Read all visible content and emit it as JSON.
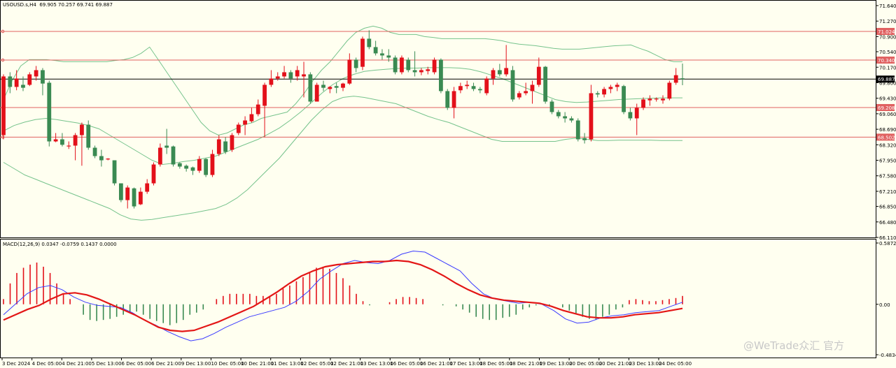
{
  "header": {
    "symbol": "USOUSD.s,H4",
    "ohlc": "69.905 70.257 69.741 69.887"
  },
  "macd_header": {
    "label": "MACD(12,26,9) 0.0347 -0.0759 0.1437 0.0000"
  },
  "watermark": "@WeTrade众汇 官方",
  "colors": {
    "background": "#fffff0",
    "bull": "#e3101a",
    "bear": "#3a8a52",
    "band": "#76c38c",
    "hline": "#e06060",
    "price_line": "#000000",
    "macd_line": "#3b3bff",
    "signal_line": "#e31616"
  },
  "chart_data": [
    {
      "type": "candlestick",
      "name": "price",
      "ylim": [
        66.11,
        71.64
      ],
      "yticks": [
        "71.640",
        "71.270",
        "70.900",
        "70.540",
        "70.170",
        "69.800",
        "69.430",
        "69.060",
        "68.690",
        "68.320",
        "67.950",
        "67.580",
        "67.210",
        "66.850",
        "66.480",
        "66.110"
      ],
      "current_price": "69.887",
      "levels": [
        {
          "value": 71.024,
          "label": "71.024"
        },
        {
          "value": 70.34,
          "label": "70.340"
        },
        {
          "value": 69.208,
          "label": "69.208"
        },
        {
          "value": 68.502,
          "label": "68.502"
        }
      ],
      "x_labels": [
        "3 Dec 2024",
        "4 Dec 05:00",
        "4 Dec 21:00",
        "5 Dec 13:00",
        "6 Dec 05:00",
        "6 Dec 21:00",
        "9 Dec 13:00",
        "10 Dec 05:00",
        "10 Dec 21:00",
        "11 Dec 13:00",
        "12 Dec 05:00",
        "12 Dec 21:00",
        "13 Dec 13:00",
        "16 Dec 05:00",
        "16 Dec 21:00",
        "17 Dec 13:00",
        "18 Dec 05:00",
        "18 Dec 21:00",
        "19 Dec 13:00",
        "20 Dec 05:00",
        "20 Dec 21:00",
        "23 Dec 13:00",
        "24 Dec 05:00"
      ],
      "candles": [
        [
          68.55,
          69.95,
          70.0,
          68.45
        ],
        [
          69.95,
          69.7,
          70.05,
          69.55
        ],
        [
          69.7,
          69.9,
          70.1,
          69.62
        ],
        [
          69.75,
          69.68,
          69.95,
          69.6
        ],
        [
          69.75,
          70.0,
          70.05,
          69.72
        ],
        [
          69.95,
          70.1,
          70.2,
          69.85
        ],
        [
          70.1,
          69.78,
          70.15,
          69.5
        ],
        [
          69.8,
          68.4,
          69.85,
          68.28
        ],
        [
          68.4,
          68.45,
          68.6,
          68.38
        ],
        [
          68.45,
          68.32,
          68.6,
          68.28
        ],
        [
          68.28,
          68.3,
          68.4,
          68.22
        ],
        [
          68.3,
          68.55,
          68.6,
          67.95
        ],
        [
          68.55,
          68.8,
          68.85,
          67.82
        ],
        [
          68.8,
          68.25,
          68.9,
          68.2
        ],
        [
          68.25,
          68.05,
          68.3,
          68.0
        ],
        [
          68.05,
          67.95,
          68.2,
          67.8
        ],
        [
          67.97,
          67.99,
          68.0,
          67.95
        ],
        [
          67.95,
          67.4,
          67.95,
          67.35
        ],
        [
          67.4,
          67.0,
          67.4,
          66.95
        ],
        [
          67.0,
          67.3,
          67.35,
          66.8
        ],
        [
          67.28,
          66.85,
          67.3,
          66.8
        ],
        [
          66.9,
          67.2,
          67.3,
          66.88
        ],
        [
          67.2,
          67.4,
          67.5,
          67.15
        ],
        [
          67.4,
          67.85,
          67.9,
          67.35
        ],
        [
          67.85,
          68.25,
          68.35,
          67.8
        ],
        [
          68.3,
          68.25,
          68.7,
          68.1
        ],
        [
          68.28,
          67.85,
          68.3,
          67.8
        ],
        [
          67.88,
          67.8,
          67.9,
          67.75
        ],
        [
          67.82,
          67.75,
          67.85,
          67.68
        ],
        [
          67.78,
          67.7,
          67.8,
          67.6
        ],
        [
          67.7,
          67.98,
          68.05,
          67.65
        ],
        [
          67.98,
          67.6,
          68.0,
          67.55
        ],
        [
          67.6,
          68.1,
          68.2,
          67.55
        ],
        [
          68.1,
          68.45,
          68.55,
          68.05
        ],
        [
          68.4,
          68.15,
          68.5,
          68.1
        ],
        [
          68.2,
          68.55,
          68.6,
          68.15
        ],
        [
          68.6,
          68.8,
          68.85,
          68.55
        ],
        [
          68.8,
          68.9,
          69.0,
          68.55
        ],
        [
          68.88,
          69.05,
          69.2,
          68.85
        ],
        [
          69.05,
          69.28,
          69.4,
          69.0
        ],
        [
          69.25,
          69.75,
          69.8,
          68.5
        ],
        [
          69.75,
          69.9,
          70.1,
          69.7
        ],
        [
          69.9,
          69.95,
          70.05,
          69.85
        ],
        [
          69.95,
          70.05,
          70.2,
          69.9
        ],
        [
          70.05,
          69.9,
          70.1,
          69.8
        ],
        [
          69.95,
          70.1,
          70.2,
          69.85
        ],
        [
          69.95,
          70.0,
          70.3,
          69.45
        ],
        [
          70.0,
          69.35,
          70.05,
          69.3
        ],
        [
          69.35,
          69.75,
          69.8,
          69.35
        ],
        [
          69.75,
          69.68,
          69.85,
          69.6
        ],
        [
          69.65,
          69.7,
          69.72,
          69.55
        ],
        [
          69.72,
          69.68,
          69.8,
          69.55
        ],
        [
          69.68,
          69.78,
          69.8,
          69.6
        ],
        [
          69.78,
          70.35,
          70.5,
          69.75
        ],
        [
          70.35,
          70.15,
          70.4,
          70.05
        ],
        [
          70.18,
          70.85,
          70.9,
          70.1
        ],
        [
          70.85,
          70.65,
          71.05,
          70.6
        ],
        [
          70.65,
          70.5,
          70.8,
          70.45
        ],
        [
          70.5,
          70.45,
          70.6,
          70.35
        ],
        [
          70.45,
          70.4,
          70.6,
          70.3
        ],
        [
          70.4,
          70.05,
          70.45,
          70.0
        ],
        [
          70.05,
          70.4,
          70.45,
          70.0
        ],
        [
          70.35,
          70.1,
          70.4,
          70.05
        ],
        [
          70.1,
          70.05,
          70.55,
          69.95
        ],
        [
          70.05,
          70.1,
          70.15,
          69.98
        ],
        [
          70.08,
          70.12,
          70.18,
          70.0
        ],
        [
          70.05,
          70.35,
          70.4,
          70.0
        ],
        [
          70.35,
          69.6,
          70.38,
          69.55
        ],
        [
          69.6,
          69.2,
          69.65,
          69.15
        ],
        [
          69.2,
          69.6,
          69.7,
          68.95
        ],
        [
          69.62,
          69.72,
          69.8,
          69.55
        ],
        [
          69.72,
          69.75,
          69.85,
          69.65
        ],
        [
          69.72,
          69.65,
          69.8,
          69.6
        ],
        [
          69.65,
          69.62,
          69.7,
          69.55
        ],
        [
          69.55,
          69.9,
          69.95,
          69.5
        ],
        [
          69.9,
          70.1,
          70.15,
          69.75
        ],
        [
          70.1,
          70.0,
          70.25,
          69.95
        ],
        [
          70.0,
          70.15,
          70.7,
          69.95
        ],
        [
          70.1,
          69.4,
          70.2,
          69.35
        ],
        [
          69.45,
          69.55,
          69.6,
          69.4
        ],
        [
          69.55,
          69.6,
          69.8,
          69.5
        ],
        [
          69.6,
          69.75,
          69.85,
          69.3
        ],
        [
          69.75,
          70.18,
          70.4,
          69.7
        ],
        [
          70.18,
          69.35,
          70.2,
          69.3
        ],
        [
          69.35,
          69.1,
          69.4,
          69.05
        ],
        [
          69.1,
          69.0,
          69.15,
          68.95
        ],
        [
          69.0,
          68.95,
          69.1,
          68.85
        ],
        [
          68.95,
          68.9,
          69.0,
          68.85
        ],
        [
          68.9,
          68.45,
          68.95,
          68.4
        ],
        [
          68.48,
          68.43,
          68.6,
          68.35
        ],
        [
          68.45,
          69.55,
          69.75,
          68.4
        ],
        [
          69.55,
          69.52,
          69.6,
          69.45
        ],
        [
          69.52,
          69.65,
          69.7,
          69.45
        ],
        [
          69.65,
          69.7,
          69.75,
          69.55
        ],
        [
          69.7,
          69.75,
          69.8,
          69.6
        ],
        [
          69.72,
          69.1,
          69.75,
          69.05
        ],
        [
          69.1,
          68.95,
          69.2,
          68.9
        ],
        [
          68.95,
          69.2,
          69.3,
          68.55
        ],
        [
          69.2,
          69.4,
          69.45,
          69.15
        ],
        [
          69.38,
          69.42,
          69.5,
          69.25
        ],
        [
          69.4,
          69.42,
          69.45,
          69.35
        ],
        [
          69.38,
          69.42,
          69.5,
          69.3
        ],
        [
          69.42,
          69.8,
          69.85,
          69.38
        ],
        [
          69.8,
          69.98,
          70.15,
          69.75
        ],
        [
          69.905,
          69.887,
          70.257,
          69.741
        ]
      ],
      "bands_upper": [
        69.4,
        69.85,
        70.2,
        70.35,
        70.35,
        70.35,
        70.33,
        70.3,
        70.3,
        70.3,
        70.3,
        70.3,
        70.3,
        70.33,
        70.35,
        70.4,
        70.5,
        70.65,
        70.35,
        70.05,
        69.75,
        69.45,
        69.15,
        68.85,
        68.65,
        68.55,
        68.6,
        68.7,
        68.8,
        68.85,
        68.95,
        69.0,
        69.05,
        69.1,
        69.3,
        69.55,
        69.85,
        70.1,
        70.3,
        70.55,
        70.8,
        71.0,
        71.1,
        71.15,
        71.1,
        71.0,
        70.95,
        70.95,
        70.95,
        70.9,
        70.88,
        70.85,
        70.85,
        70.85,
        70.85,
        70.85,
        70.85,
        70.83,
        70.8,
        70.75,
        70.72,
        70.7,
        70.68,
        70.65,
        70.62,
        70.6,
        70.6,
        70.6,
        70.62,
        70.64,
        70.66,
        70.68,
        70.69,
        70.7,
        70.62,
        70.55,
        70.45,
        70.35,
        70.3,
        70.3
      ],
      "bands_middle": [
        68.65,
        68.78,
        68.86,
        68.92,
        68.95,
        68.92,
        68.88,
        68.84,
        68.78,
        68.7,
        68.55,
        68.4,
        68.25,
        68.1,
        67.95,
        67.85,
        67.88,
        67.92,
        67.95,
        68.0,
        68.05,
        68.15,
        68.25,
        68.35,
        68.45,
        68.58,
        68.72,
        68.9,
        69.1,
        69.32,
        69.55,
        69.75,
        69.9,
        70.0,
        70.07,
        70.1,
        70.12,
        70.14,
        70.15,
        70.15,
        70.16,
        70.16,
        70.16,
        70.15,
        70.12,
        70.06,
        69.98,
        69.9,
        69.8,
        69.7,
        69.6,
        69.5,
        69.4,
        69.35,
        69.33,
        69.34,
        69.36,
        69.38,
        69.4,
        69.41,
        69.42,
        69.43,
        69.44,
        69.44,
        69.44
      ],
      "bands_lower": [
        67.9,
        67.75,
        67.6,
        67.5,
        67.4,
        67.3,
        67.2,
        67.1,
        67.0,
        66.9,
        66.8,
        66.65,
        66.55,
        66.52,
        66.54,
        66.58,
        66.62,
        66.66,
        66.7,
        66.75,
        66.8,
        66.9,
        67.05,
        67.25,
        67.5,
        67.75,
        68.0,
        68.3,
        68.6,
        68.9,
        69.15,
        69.35,
        69.45,
        69.48,
        69.45,
        69.4,
        69.35,
        69.3,
        69.2,
        69.1,
        69.0,
        68.92,
        68.85,
        68.75,
        68.65,
        68.55,
        68.45,
        68.4,
        68.4,
        68.4,
        68.4,
        68.4,
        68.4,
        68.45,
        68.48,
        68.45,
        68.42,
        68.42,
        68.43,
        68.43,
        68.43,
        68.43,
        68.42,
        68.42,
        68.42
      ]
    },
    {
      "type": "macd",
      "name": "MACD(12,26,9)",
      "ylim": [
        -0.4834,
        0.5872
      ],
      "yticks": [
        "0.5872",
        "0.00",
        "-0.4834"
      ],
      "histogram": [
        0.05,
        0.2,
        0.3,
        0.35,
        0.38,
        0.4,
        0.36,
        0.3,
        0.2,
        0.1,
        0.05,
        0.0,
        -0.1,
        -0.15,
        -0.16,
        -0.15,
        -0.14,
        -0.12,
        -0.1,
        -0.08,
        -0.07,
        -0.1,
        -0.14,
        -0.16,
        -0.18,
        -0.2,
        -0.18,
        -0.15,
        -0.1,
        -0.08,
        -0.05,
        0.0,
        0.05,
        0.08,
        0.1,
        0.1,
        0.1,
        0.1,
        0.08,
        0.08,
        0.08,
        0.1,
        0.15,
        0.18,
        0.22,
        0.26,
        0.3,
        0.35,
        0.36,
        0.34,
        0.3,
        0.25,
        0.18,
        0.1,
        0.03,
        -0.01,
        0.0,
        0.0,
        0.02,
        0.05,
        0.07,
        0.07,
        0.06,
        0.05,
        0.0,
        0.0,
        -0.01,
        0.0,
        -0.02,
        -0.05,
        -0.08,
        -0.12,
        -0.14,
        -0.15,
        -0.15,
        -0.13,
        -0.12,
        -0.1,
        -0.05,
        -0.03,
        -0.01,
        0.0,
        -0.01,
        0.0,
        -0.03,
        -0.06,
        -0.09,
        -0.12,
        -0.14,
        -0.15,
        -0.12,
        -0.1,
        -0.05,
        -0.03,
        0.04,
        0.05,
        0.04,
        0.03,
        0.03,
        0.04,
        0.05,
        0.06,
        0.08
      ],
      "macd_line": [
        -0.1,
        0.0,
        0.1,
        0.16,
        0.18,
        0.14,
        0.07,
        0.02,
        -0.01,
        -0.02,
        -0.03,
        -0.08,
        -0.15,
        -0.2,
        -0.26,
        -0.31,
        -0.35,
        -0.33,
        -0.28,
        -0.22,
        -0.17,
        -0.12,
        -0.09,
        -0.06,
        -0.03,
        0.03,
        0.12,
        0.24,
        0.32,
        0.39,
        0.42,
        0.4,
        0.39,
        0.42,
        0.48,
        0.51,
        0.5,
        0.44,
        0.38,
        0.32,
        0.2,
        0.1,
        0.05,
        0.03,
        0.01,
        0.02,
        0.0,
        -0.06,
        -0.14,
        -0.18,
        -0.17,
        -0.13,
        -0.11,
        -0.1,
        -0.08,
        -0.07,
        -0.06,
        -0.02,
        0.02
      ],
      "signal_line": [
        -0.15,
        -0.1,
        -0.05,
        -0.01,
        0.05,
        0.1,
        0.11,
        0.09,
        0.05,
        0.0,
        -0.05,
        -0.1,
        -0.16,
        -0.22,
        -0.25,
        -0.26,
        -0.25,
        -0.21,
        -0.17,
        -0.12,
        -0.07,
        -0.02,
        0.05,
        0.12,
        0.2,
        0.27,
        0.32,
        0.36,
        0.38,
        0.39,
        0.4,
        0.41,
        0.41,
        0.42,
        0.41,
        0.38,
        0.33,
        0.27,
        0.2,
        0.14,
        0.09,
        0.06,
        0.04,
        0.03,
        0.02,
        0.01,
        -0.02,
        -0.06,
        -0.09,
        -0.12,
        -0.13,
        -0.13,
        -0.12,
        -0.1,
        -0.09,
        -0.08,
        -0.06,
        -0.04
      ]
    }
  ]
}
